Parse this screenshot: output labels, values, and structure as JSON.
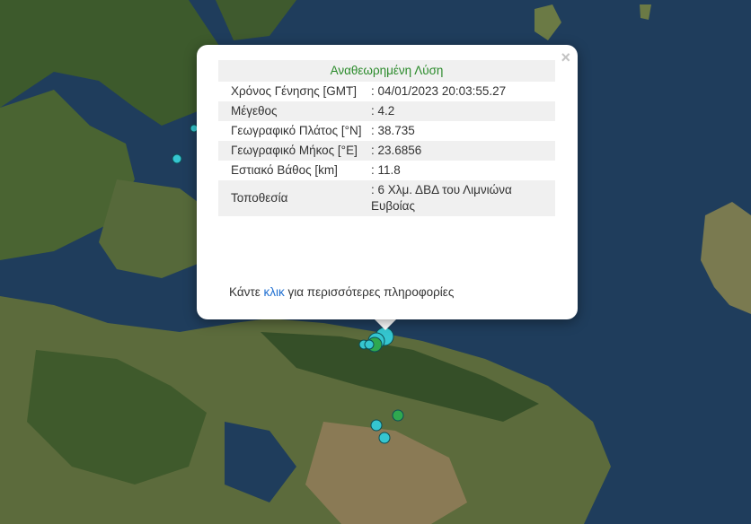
{
  "popup": {
    "header": "Αναθεωρημένη Λύση",
    "rows": [
      {
        "label": "Χρόνος Γένησης [GMT]",
        "value": ": 04/01/2023 20:03:55.27"
      },
      {
        "label": "Μέγεθος",
        "value": ": 4.2"
      },
      {
        "label": "Γεωγραφικό Πλάτος [°N]",
        "value": ": 38.735"
      },
      {
        "label": "Γεωγραφικό Μήκος [°E]",
        "value": ": 23.6856"
      },
      {
        "label": "Εστιακό Βάθος [km]",
        "value": ": 11.8"
      },
      {
        "label": "Τοποθεσία",
        "value": ": 6 Χλμ. ΔΒΔ του Λιμνιώνα Ευβοίας"
      }
    ],
    "more_prefix": "Κάντε ",
    "more_link": "κλικ",
    "more_suffix": " για περισσότερες πληροφορίες",
    "close_symbol": "×"
  },
  "colors": {
    "sea": "#1f3d5c",
    "land_dark": "#3d5a2c",
    "land_light": "#6b7a45",
    "land_brown": "#8a7a55",
    "marker_cyan": "#35c6d0",
    "marker_green": "#2fa84f",
    "header_text": "#2a8a2a",
    "link": "#1f6fd1"
  },
  "markers": [
    {
      "id": "quake-1",
      "color": "cyan"
    },
    {
      "id": "quake-2",
      "color": "cyan"
    },
    {
      "id": "quake-3",
      "color": "cyan"
    },
    {
      "id": "quake-4",
      "color": "cyan"
    },
    {
      "id": "quake-5",
      "color": "green"
    },
    {
      "id": "quake-6",
      "color": "cyan"
    },
    {
      "id": "quake-7",
      "color": "cyan"
    },
    {
      "id": "quake-8",
      "color": "green"
    },
    {
      "id": "quake-9",
      "color": "cyan"
    },
    {
      "id": "quake-10",
      "color": "cyan"
    }
  ]
}
